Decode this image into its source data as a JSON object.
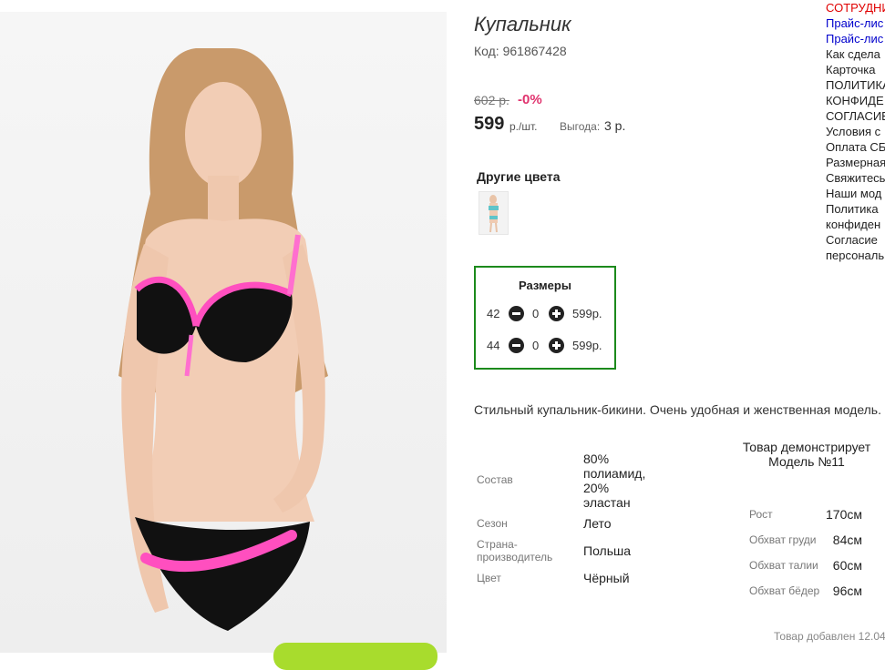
{
  "product": {
    "title": "Купальник",
    "code": "Код: 961867428",
    "old_price": "602 р.",
    "discount": "-0%",
    "price": "599",
    "price_unit": "р./шт.",
    "benefit_label": "Выгода:",
    "benefit_value": "3 р.",
    "other_colors_title": "Другие цвета",
    "description": "Стильный купальник-бикини. Очень удобная и женственная модель."
  },
  "sizes": {
    "title": "Размеры",
    "rows": [
      {
        "size": "42",
        "qty": "0",
        "price": "599р."
      },
      {
        "size": "44",
        "qty": "0",
        "price": "599р."
      }
    ]
  },
  "properties": [
    {
      "label": "Состав",
      "value": "80% полиамид, 20% эластан"
    },
    {
      "label": "Сезон",
      "value": "Лето"
    },
    {
      "label": "Страна-производитель",
      "value": "Польша"
    },
    {
      "label": "Цвет",
      "value": "Чёрный"
    }
  ],
  "model": {
    "heading": "Товар демонстрирует Модель №11",
    "params": [
      {
        "label": "Рост",
        "value": "170см"
      },
      {
        "label": "Обхват груди",
        "value": "84см"
      },
      {
        "label": "Обхват талии",
        "value": "60см"
      },
      {
        "label": "Обхват бёдер",
        "value": "96см"
      }
    ]
  },
  "added_text": "Товар добавлен 12.04",
  "sidebar": {
    "items": [
      {
        "label": "СОТРУДНИ"
      },
      {
        "label": "Прайс-лис"
      },
      {
        "label": "Прайс-лис"
      },
      {
        "label": "Как сдела"
      },
      {
        "label": "Карточка"
      },
      {
        "label": "ПОЛИТИКА"
      },
      {
        "label": "КОНФИДЕ"
      },
      {
        "label": "СОГЛАСИЕ"
      },
      {
        "label": "Условия с"
      },
      {
        "label": "Оплата СБ"
      },
      {
        "label": "Размерная"
      },
      {
        "label": "Свяжитесь"
      },
      {
        "label": "Наши мод"
      },
      {
        "label": "Политика"
      },
      {
        "label": "конфиден"
      },
      {
        "label": "Согласие"
      },
      {
        "label": "персональ"
      }
    ]
  },
  "colors": {
    "accent_pink": "#e0336e",
    "frame_green": "#1c8a1c",
    "button_green": "#a8dc2d"
  }
}
